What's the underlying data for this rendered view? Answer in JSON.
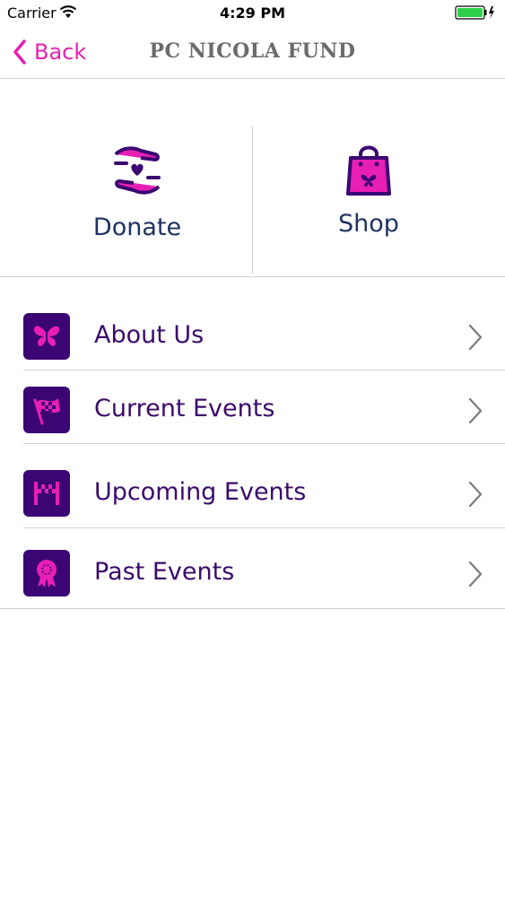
{
  "status_bar": {
    "carrier": "Carrier",
    "time": "4:29 PM"
  },
  "nav": {
    "back_label": "Back",
    "title": "PC NICOLA FUND"
  },
  "actions": {
    "donate_label": "Donate",
    "shop_label": "Shop"
  },
  "menu": {
    "items": [
      {
        "label": "About Us",
        "icon": "butterfly-icon"
      },
      {
        "label": "Current Events",
        "icon": "checkered-flag-icon"
      },
      {
        "label": "Upcoming Events",
        "icon": "finish-line-icon"
      },
      {
        "label": "Past Events",
        "icon": "award-ribbon-icon"
      }
    ]
  },
  "colors": {
    "accent": "#e81fb4",
    "tile": "#3b0673",
    "label": "#3b0a6a",
    "action_label": "#1f3161"
  }
}
